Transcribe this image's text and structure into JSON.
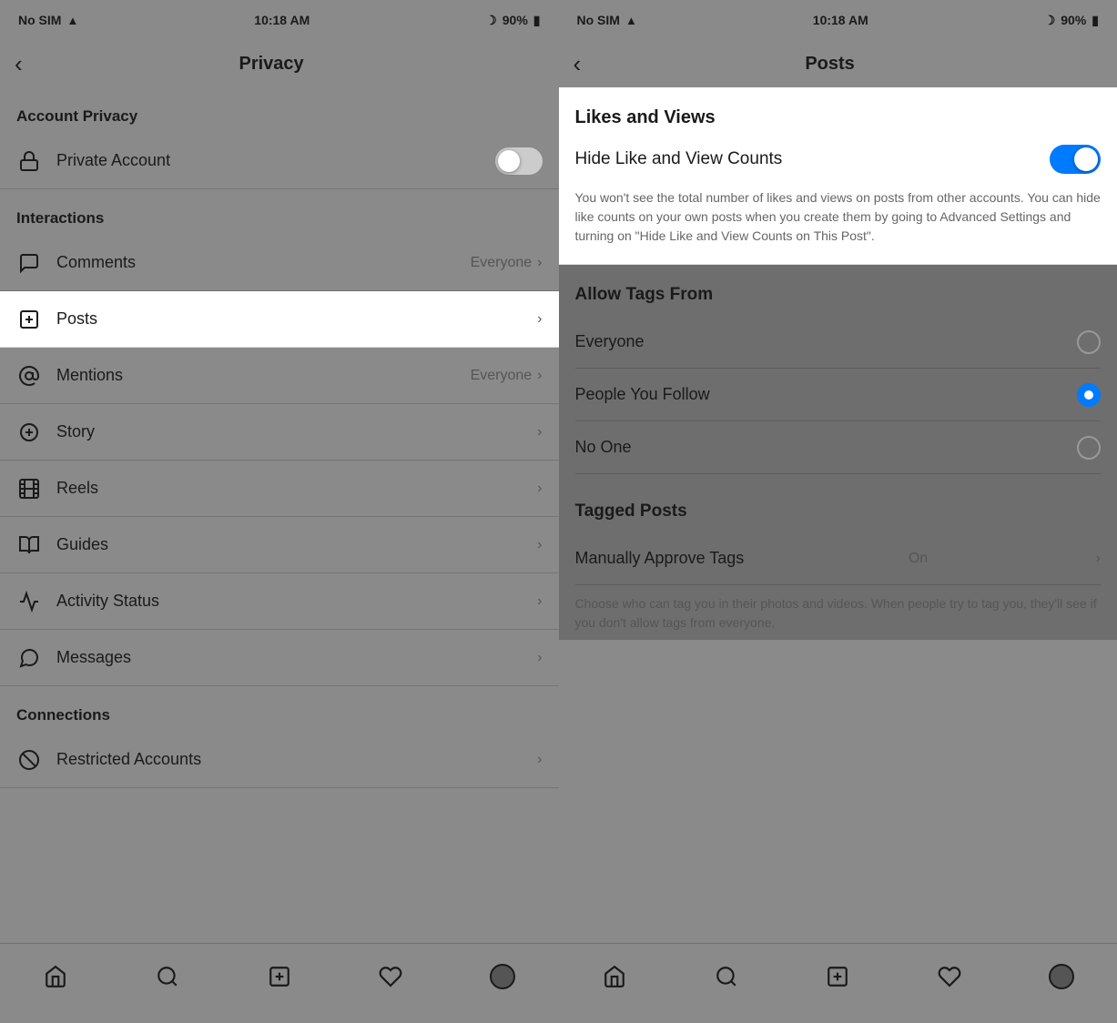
{
  "left_phone": {
    "status": {
      "carrier": "No SIM",
      "time": "10:18 AM",
      "battery": "90%"
    },
    "nav": {
      "back_label": "‹",
      "title": "Privacy"
    },
    "sections": [
      {
        "header": "Account Privacy",
        "items": [
          {
            "id": "private-account",
            "icon": "lock",
            "label": "Private Account",
            "value": "",
            "has_toggle": true,
            "toggle_on": false,
            "has_chevron": false
          }
        ]
      },
      {
        "header": "Interactions",
        "items": [
          {
            "id": "comments",
            "icon": "comment",
            "label": "Comments",
            "value": "Everyone",
            "has_toggle": false,
            "has_chevron": true
          },
          {
            "id": "posts",
            "icon": "plus-square",
            "label": "Posts",
            "value": "",
            "has_toggle": false,
            "has_chevron": true,
            "active": true
          },
          {
            "id": "mentions",
            "icon": "at",
            "label": "Mentions",
            "value": "Everyone",
            "has_toggle": false,
            "has_chevron": true
          },
          {
            "id": "story",
            "icon": "plus-circle",
            "label": "Story",
            "value": "",
            "has_toggle": false,
            "has_chevron": true
          },
          {
            "id": "reels",
            "icon": "film",
            "label": "Reels",
            "value": "",
            "has_toggle": false,
            "has_chevron": true
          },
          {
            "id": "guides",
            "icon": "book-open",
            "label": "Guides",
            "value": "",
            "has_toggle": false,
            "has_chevron": true
          },
          {
            "id": "activity-status",
            "icon": "activity",
            "label": "Activity Status",
            "value": "",
            "has_toggle": false,
            "has_chevron": true
          },
          {
            "id": "messages",
            "icon": "message-circle",
            "label": "Messages",
            "value": "",
            "has_toggle": false,
            "has_chevron": true
          }
        ]
      },
      {
        "header": "Connections",
        "items": [
          {
            "id": "restricted-accounts",
            "icon": "slash-circle",
            "label": "Restricted Accounts",
            "value": "",
            "has_toggle": false,
            "has_chevron": true
          }
        ]
      }
    ],
    "tabs": [
      "home",
      "search",
      "plus",
      "heart",
      "profile"
    ]
  },
  "right_phone": {
    "status": {
      "carrier": "No SIM",
      "time": "10:18 AM",
      "battery": "90%"
    },
    "nav": {
      "back_label": "‹",
      "title": "Posts"
    },
    "likes_views": {
      "section_title": "Likes and Views",
      "toggle_label": "Hide Like and View Counts",
      "toggle_on": true,
      "description": "You won't see the total number of likes and views on posts from other accounts. You can hide like counts on your own posts when you create them by going to Advanced Settings and turning on \"Hide Like and View Counts on This Post\"."
    },
    "allow_tags": {
      "section_title": "Allow Tags From",
      "options": [
        {
          "id": "everyone",
          "label": "Everyone",
          "selected": false
        },
        {
          "id": "people-you-follow",
          "label": "People You Follow",
          "selected": true
        },
        {
          "id": "no-one",
          "label": "No One",
          "selected": false
        }
      ]
    },
    "tagged_posts": {
      "section_title": "Tagged Posts",
      "manually_approve": {
        "label": "Manually Approve Tags",
        "value": "On"
      },
      "description": "Choose who can tag you in their photos and videos. When people try to tag you, they'll see if you don't allow tags from everyone."
    },
    "tabs": [
      "home",
      "search",
      "plus",
      "heart",
      "profile"
    ]
  }
}
